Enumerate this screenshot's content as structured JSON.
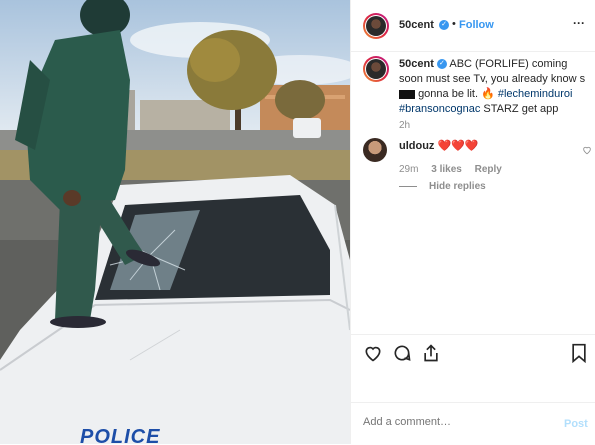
{
  "post": {
    "username": "50cent",
    "follow_label": "Follow",
    "more_label": "···",
    "caption_user": "50cent",
    "caption_1": "ABC (FORLIFE) coming soon must see Tv, you already know s",
    "caption_2": "gonna be lit.",
    "caption_fire": "🔥",
    "hashtag_1": "#lecheminduroi",
    "hashtag_2": "#bransoncognac",
    "caption_3": "STARZ get app",
    "caption_age": "2h"
  },
  "comment": {
    "username": "uldouz",
    "hearts": "❤️❤️❤️",
    "age": "29m",
    "likes": "3 likes",
    "reply": "Reply",
    "hide_replies": "Hide replies"
  },
  "photo": {
    "car_text": "POLICE"
  },
  "composer": {
    "placeholder": "Add a comment…",
    "post_label": "Post"
  },
  "icons": [
    "heart-icon",
    "comment-icon",
    "share-icon",
    "bookmark-icon",
    "verified-icon",
    "fire-emoji",
    "more-icon"
  ],
  "colors": {
    "link": "#3897f0",
    "hashtag": "#00376b",
    "meta": "#8e8e8e",
    "border": "#efefef"
  }
}
